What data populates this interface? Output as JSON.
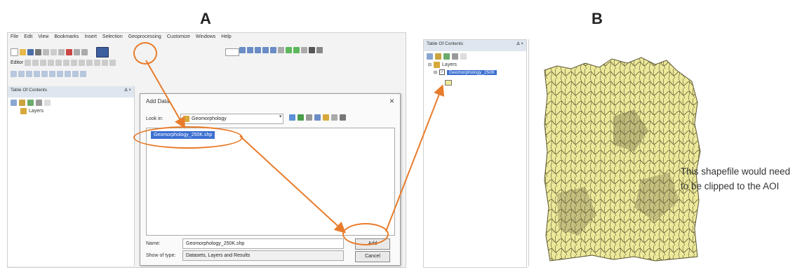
{
  "labels": {
    "a": "A",
    "b": "B"
  },
  "menu": [
    "File",
    "Edit",
    "View",
    "Bookmarks",
    "Insert",
    "Selection",
    "Geoprocessing",
    "Customize",
    "Windows",
    "Help"
  ],
  "editor_label": "Editor",
  "toc": {
    "title": "Table Of Contents",
    "controls": "Δ ×",
    "layers_label": "Layers"
  },
  "dialog": {
    "title": "Add Data",
    "close": "×",
    "look_in_label": "Look in:",
    "look_in_value": "Geomorphology",
    "selected_file": "Geomorphology_250K.shp",
    "name_label": "Name:",
    "name_value": "Geomorphology_250K.shp",
    "show_type_label": "Show of type:",
    "show_type_value": "Datasets, Layers and Results",
    "add_button": "Add",
    "cancel_button": "Cancel"
  },
  "tocB": {
    "title": "Table Of Contents",
    "controls": "Δ ×",
    "layers_label": "Layers",
    "layer_name": "Geomorphology_250K"
  },
  "annotation": "This shapefile would need to be clipped to the AOI",
  "colors": {
    "callout": "#e87c2c",
    "selection": "#3b6fd1",
    "map_fill": "#ece99a",
    "map_line": "#5a5430"
  }
}
